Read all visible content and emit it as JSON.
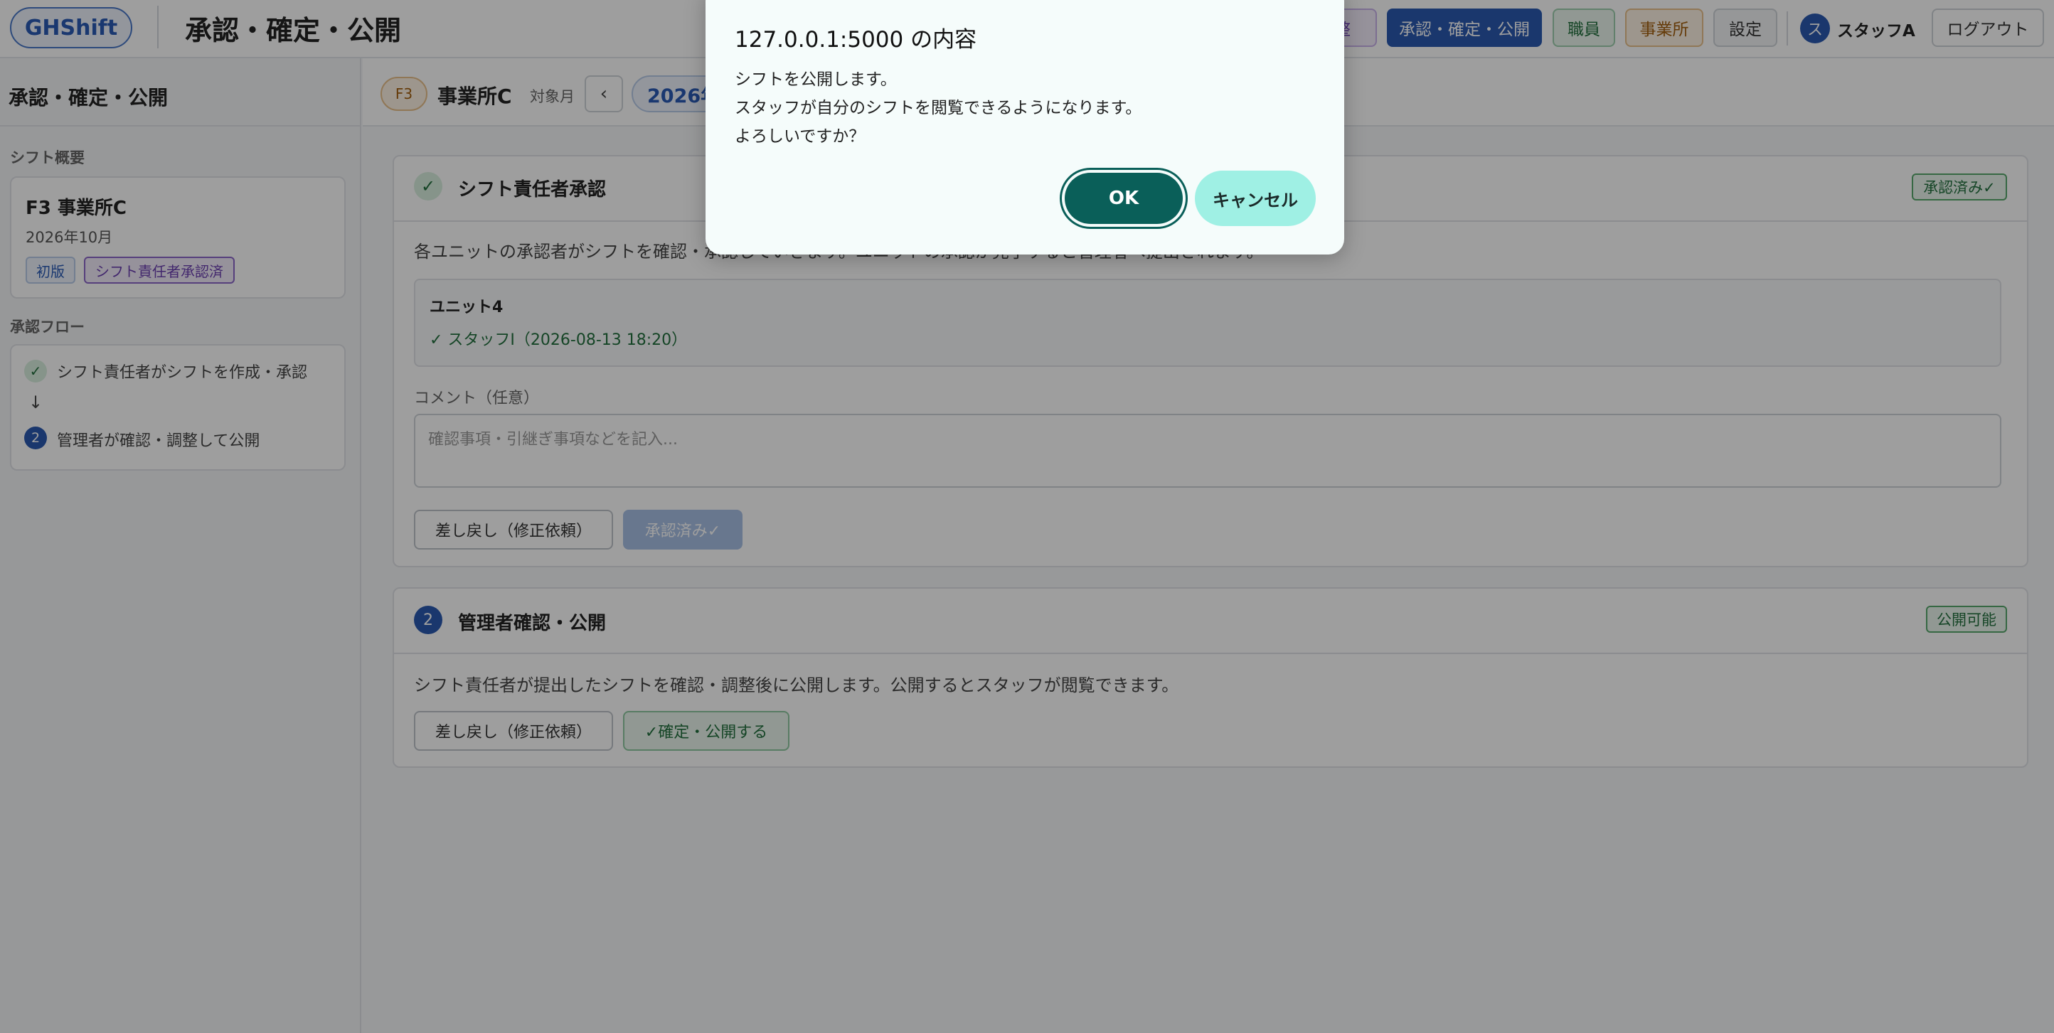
{
  "header": {
    "logo": "GHShift",
    "title": "承認・確定・公開",
    "nav": {
      "adjust": "整",
      "approve": "承認・確定・公開",
      "staff": "職員",
      "office": "事業所",
      "settings": "設定"
    },
    "user": {
      "avatar": "ス",
      "name": "スタッフA"
    },
    "logout": "ログアウト"
  },
  "sidebar": {
    "title": "承認・確定・公開",
    "overview_label": "シフト概要",
    "overview": {
      "name": "F3 事業所C",
      "month": "2026年10月",
      "tags": [
        "初版",
        "シフト責任者承認済"
      ]
    },
    "flow_label": "承認フロー",
    "flow": {
      "step1_icon": "✓",
      "step1": "シフト責任者がシフトを作成・承認",
      "arrow": "↓",
      "step2_num": "2",
      "step2": "管理者が確認・調整して公開"
    }
  },
  "subheader": {
    "office_code": "F3",
    "office_name": "事業所C",
    "target_label": "対象月",
    "prev": "‹",
    "month": "2026年"
  },
  "section1": {
    "icon": "✓",
    "title": "シフト責任者承認",
    "status": "承認済み✓",
    "description": "各ユニットの承認者がシフトを確認・承認していきます。ユニットの承認が完了すると管理者へ提出されます。",
    "unit_name": "ユニット4",
    "unit_approver": "✓ スタッフI（2026-08-13 18:20）",
    "comment_label": "コメント（任意）",
    "comment_placeholder": "確認事項・引継ぎ事項などを記入...",
    "return_button": "差し戻し（修正依頼）",
    "approved_button": "承認済み✓"
  },
  "section2": {
    "num": "2",
    "title": "管理者確認・公開",
    "status": "公開可能",
    "description": "シフト責任者が提出したシフトを確認・調整後に公開します。公開するとスタッフが閲覧できます。",
    "return_button": "差し戻し（修正依頼）",
    "publish_button": "✓確定・公開する"
  },
  "dialog": {
    "title": "127.0.0.1:5000 の内容",
    "lines": [
      "シフトを公開します。",
      "スタッフが自分のシフトを閲覧できるようになります。",
      "よろしいですか？"
    ],
    "ok": "OK",
    "cancel": "キャンセル"
  },
  "colors": {
    "primary": "#2b5ab0",
    "success": "#23703e",
    "dialog_ok": "#0a5f59",
    "dialog_cancel": "#9ff0e4"
  }
}
